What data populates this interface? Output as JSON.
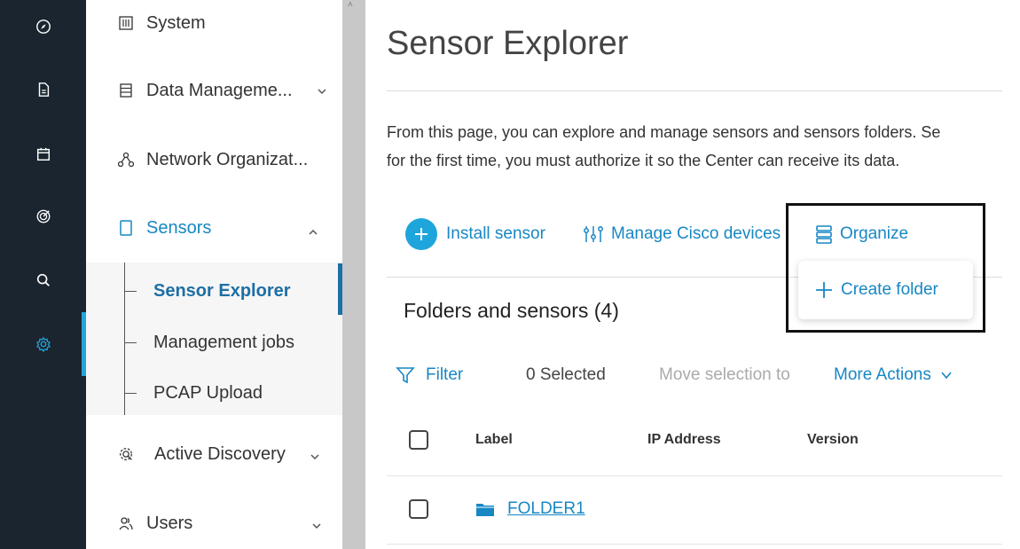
{
  "colors": {
    "rail_bg": "#1a252f",
    "accent": "#1787c4",
    "accent_bright": "#26a4d9"
  },
  "rail": {
    "icons": [
      "compass-icon",
      "document-icon",
      "calendar-icon",
      "target-icon",
      "search-icon",
      "gear-icon"
    ],
    "active": "gear-icon"
  },
  "sidebar": {
    "items": [
      {
        "label": "System",
        "icon": "system-icon"
      },
      {
        "label": "Data Manageme...",
        "icon": "database-icon",
        "chevron": "down"
      },
      {
        "label": "Network Organizat...",
        "icon": "network-icon"
      },
      {
        "label": "Sensors",
        "icon": "tablet-icon",
        "chevron": "up",
        "active": true
      },
      {
        "label": "Active Discovery",
        "icon": "discovery-icon",
        "chevron": "down"
      },
      {
        "label": "Users",
        "icon": "users-icon",
        "chevron": "down"
      }
    ],
    "submenu": [
      {
        "label": "Sensor Explorer",
        "active": true
      },
      {
        "label": "Management jobs"
      },
      {
        "label": "PCAP Upload"
      }
    ]
  },
  "main": {
    "title": "Sensor Explorer",
    "description_line1": "From this page, you can explore and manage sensors and sensors folders. Se",
    "description_line2": "for the first time, you must authorize it so the Center can receive its data.",
    "toolbar": {
      "install_sensor": "Install sensor",
      "manage_cisco": "Manage Cisco devices",
      "organize": "Organize"
    },
    "organize_menu": {
      "create_folder": "Create folder"
    },
    "section_title": "Folders and sensors (4)",
    "filter_bar": {
      "filter": "Filter",
      "selected": "0 Selected",
      "move_selection": "Move selection to",
      "more_actions": "More Actions"
    },
    "table": {
      "columns": [
        "Label",
        "IP Address",
        "Version"
      ],
      "rows": [
        {
          "label": "FOLDER1",
          "ip": "",
          "version": ""
        }
      ]
    }
  }
}
